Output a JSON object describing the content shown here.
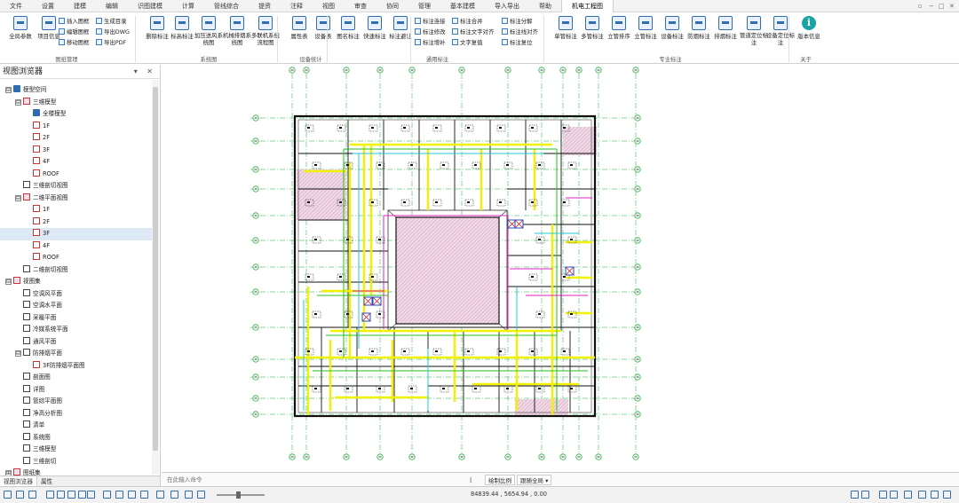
{
  "menu": {
    "items": [
      "文件",
      "设置",
      "建模",
      "编辑",
      "识图建模",
      "计算",
      "管线综合",
      "提资",
      "注释",
      "视图",
      "审查",
      "协同",
      "管理",
      "基本建模",
      "导入导出",
      "帮助",
      "机电工程图"
    ],
    "active_index": 16,
    "window_controls": [
      "▫",
      "−",
      "□",
      "✕"
    ]
  },
  "ribbon": {
    "buttons": [
      {
        "name": "global-params",
        "label": "全局参数"
      },
      {
        "name": "project-info",
        "label": "项目信息"
      },
      {
        "name": "delete-annotation",
        "label": "删除标注"
      },
      {
        "name": "elevation-annotation",
        "label": "标高标注"
      },
      {
        "name": "pressurized-air-system",
        "label": "加压送风系统图"
      },
      {
        "name": "mech-smoke-system",
        "label": "机械排烟系统图"
      },
      {
        "name": "multi-unit-flowchart",
        "label": "多联机系统流程图"
      },
      {
        "name": "property-table",
        "label": "属性表"
      },
      {
        "name": "equipment-table",
        "label": "设备表"
      },
      {
        "name": "figure-annotation",
        "label": "图名标注"
      },
      {
        "name": "quick-annotation",
        "label": "快速标注"
      },
      {
        "name": "annotation-avoid",
        "label": "标注避让"
      },
      {
        "name": "single-pipe-annotation",
        "label": "单管标注"
      },
      {
        "name": "multi-pipe-annotation",
        "label": "多管标注"
      },
      {
        "name": "vertical-pipe-sort",
        "label": "立管排序"
      },
      {
        "name": "vertical-pipe-annotation",
        "label": "立管标注"
      },
      {
        "name": "equipment-annotation",
        "label": "设备标注"
      },
      {
        "name": "fire-damper-annotation",
        "label": "防烟标注"
      },
      {
        "name": "smoke-exhaust-annotation",
        "label": "排烟标注"
      },
      {
        "name": "pipe-locate-annotation",
        "label": "管道定位标注"
      },
      {
        "name": "equipment-locate-annotation",
        "label": "设备定位标注"
      },
      {
        "name": "version-info",
        "label": "版本信息"
      }
    ],
    "small_buttons": [
      {
        "name": "insert-frame",
        "label": "插入图框"
      },
      {
        "name": "edit-frame",
        "label": "编辑图框"
      },
      {
        "name": "move-frame",
        "label": "移动图框"
      },
      {
        "name": "generate-catalog",
        "label": "生成目录"
      },
      {
        "name": "export-dwg",
        "label": "导出DWG"
      },
      {
        "name": "export-pdf",
        "label": "导出PDF"
      },
      {
        "name": "annotation-connect",
        "label": "标注连接"
      },
      {
        "name": "annotation-modify",
        "label": "标注修改"
      },
      {
        "name": "annotation-supplement",
        "label": "标注增补"
      },
      {
        "name": "annotation-merge",
        "label": "标注合并"
      },
      {
        "name": "annotation-text-align",
        "label": "标注文字对齐"
      },
      {
        "name": "text-restore",
        "label": "文字复值"
      },
      {
        "name": "annotation-split",
        "label": "标注分解"
      },
      {
        "name": "annotation-line-align",
        "label": "标注线对齐"
      },
      {
        "name": "annotation-reset",
        "label": "标注复位"
      }
    ],
    "groups": [
      "图纸管理",
      "系统图",
      "设备统计",
      "通用标注",
      "专业标注",
      "关于"
    ]
  },
  "browser": {
    "title": "视图浏览器",
    "controls": "▾ ✕",
    "tree": [
      {
        "label": "模型空间",
        "level": 0,
        "toggle": "⊟",
        "icon": "cube"
      },
      {
        "label": "三维模型",
        "level": 1,
        "toggle": "⊟",
        "icon": "set"
      },
      {
        "label": "全楼模型",
        "level": 2,
        "toggle": "",
        "icon": "cube"
      },
      {
        "label": "1F",
        "level": 2,
        "toggle": "",
        "icon": "plan"
      },
      {
        "label": "2F",
        "level": 2,
        "toggle": "",
        "icon": "plan"
      },
      {
        "label": "3F",
        "level": 2,
        "toggle": "",
        "icon": "plan"
      },
      {
        "label": "4F",
        "level": 2,
        "toggle": "",
        "icon": "plan"
      },
      {
        "label": "ROOF",
        "level": 2,
        "toggle": "",
        "icon": "plan"
      },
      {
        "label": "三维剖切视图",
        "level": 1,
        "toggle": "",
        "icon": "sec"
      },
      {
        "label": "二维平面视图",
        "level": 1,
        "toggle": "⊟",
        "icon": "set"
      },
      {
        "label": "1F",
        "level": 2,
        "toggle": "",
        "icon": "plan"
      },
      {
        "label": "2F",
        "level": 2,
        "toggle": "",
        "icon": "plan"
      },
      {
        "label": "3F",
        "level": 2,
        "toggle": "",
        "icon": "plan"
      },
      {
        "label": "4F",
        "level": 2,
        "toggle": "",
        "icon": "plan"
      },
      {
        "label": "ROOF",
        "level": 2,
        "toggle": "",
        "icon": "plan"
      },
      {
        "label": "二维剖切视图",
        "level": 1,
        "toggle": "",
        "icon": "sec"
      },
      {
        "label": "视图集",
        "level": 0,
        "toggle": "⊟",
        "icon": "set"
      },
      {
        "label": "空调风平面",
        "level": 1,
        "toggle": "",
        "icon": "sec"
      },
      {
        "label": "空调水平面",
        "level": 1,
        "toggle": "",
        "icon": "sec"
      },
      {
        "label": "采暖平面",
        "level": 1,
        "toggle": "",
        "icon": "sec"
      },
      {
        "label": "冷媒系统平面",
        "level": 1,
        "toggle": "",
        "icon": "sec"
      },
      {
        "label": "通风平面",
        "level": 1,
        "toggle": "",
        "icon": "sec"
      },
      {
        "label": "防排烟平面",
        "level": 1,
        "toggle": "⊟",
        "icon": "sec"
      },
      {
        "label": "3F防排烟平面图",
        "level": 2,
        "toggle": "",
        "icon": "plan"
      },
      {
        "label": "剖面图",
        "level": 1,
        "toggle": "",
        "icon": "sec"
      },
      {
        "label": "详图",
        "level": 1,
        "toggle": "",
        "icon": "sec"
      },
      {
        "label": "管综平面图",
        "level": 1,
        "toggle": "",
        "icon": "sec"
      },
      {
        "label": "净高分析图",
        "level": 1,
        "toggle": "",
        "icon": "sec"
      },
      {
        "label": "清单",
        "level": 1,
        "toggle": "",
        "icon": "sec"
      },
      {
        "label": "系统图",
        "level": 1,
        "toggle": "",
        "icon": "sec"
      },
      {
        "label": "三维模型",
        "level": 1,
        "toggle": "",
        "icon": "sec"
      },
      {
        "label": "三维剖切",
        "level": 1,
        "toggle": "",
        "icon": "sec"
      },
      {
        "label": "图纸集",
        "level": 0,
        "toggle": "⊞",
        "icon": "set"
      }
    ],
    "selected_index": 12,
    "tabs": [
      "视图浏览器",
      "属性"
    ]
  },
  "command": {
    "placeholder": "在此输入命令",
    "scale_label": "绘制比例",
    "view_mode": "跟随全局",
    "arrow": "▾"
  },
  "status": {
    "coords": "84839.44 , 5654.94 , 0.00"
  },
  "colors": {
    "accent": "#2f6fb0",
    "wall": "#111111",
    "duct_yellow": "#f2f200",
    "pipe_green": "#22c222",
    "pipe_cyan": "#22c8d8",
    "pipe_magenta": "#e020c0",
    "grid_green": "#1fae3a",
    "hatch_pink": "#e8bfd6"
  }
}
